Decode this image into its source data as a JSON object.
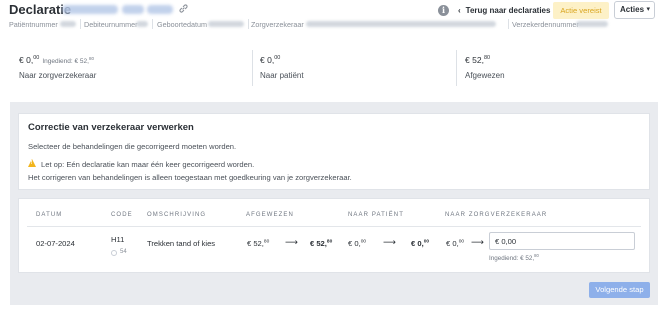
{
  "header": {
    "title": "Declaratie",
    "meta": [
      {
        "label": "Patiëntnummer"
      },
      {
        "label": "Debiteurnummer"
      },
      {
        "label": "Geboortedatum"
      },
      {
        "label": "Zorgverzekeraar"
      },
      {
        "label": "Verzekerdennummer"
      }
    ],
    "info_icon": "info-icon",
    "back_link": "Terug naar declaraties",
    "status_badge": "Actie vereist",
    "actions_label": "Acties",
    "colors": {
      "badge_bg": "#fdf1c7",
      "badge_text": "#d9a51f",
      "link_icon": "#8a9099"
    }
  },
  "summary": [
    {
      "currency": "€",
      "int": "0",
      "dec": "00",
      "submitted_label": "Ingediend: € 52",
      "submitted_dec": "80",
      "label": "Naar zorgverzekeraar"
    },
    {
      "currency": "€",
      "int": "0",
      "dec": "00",
      "label": "Naar patiënt"
    },
    {
      "currency": "€",
      "int": "52",
      "dec": "80",
      "label": "Afgewezen"
    }
  ],
  "correction": {
    "title": "Correctie van verzekeraar verwerken",
    "instruction": "Selecteer de behandelingen die gecorrigeerd moeten worden.",
    "warning_line1": "Let op: Eén declaratie kan maar één keer gecorrigeerd worden.",
    "warning_line2": "Het corrigeren van behandelingen is alleen toegestaan met goedkeuring van je zorgverzekeraar.",
    "warning_color": "#f2b51d"
  },
  "table": {
    "columns": [
      "DATUM",
      "CODE",
      "OMSCHRIJVING",
      "AFGEWEZEN",
      "NAAR PATIËNT",
      "NAAR ZORGVERZEKERAAR"
    ],
    "row": {
      "date": "02-07-2024",
      "code": "H11",
      "code_sub": "54",
      "description": "Trekken tand of kies",
      "rejected_from_int": "€ 52",
      "rejected_from_dec": "80",
      "rejected_to_int": "€ 52",
      "rejected_to_dec": "80",
      "patient_from_int": "€ 0",
      "patient_from_dec": "00",
      "patient_to_int": "€ 0",
      "patient_to_dec": "00",
      "insurer_from_int": "€ 0",
      "insurer_from_dec": "00",
      "insurer_input_value": "€ 0,00",
      "insurer_submitted": "Ingediend: € 52",
      "insurer_submitted_dec": "80"
    }
  },
  "footer": {
    "next_label": "Volgende stap",
    "next_color": "#8eb0ea"
  }
}
